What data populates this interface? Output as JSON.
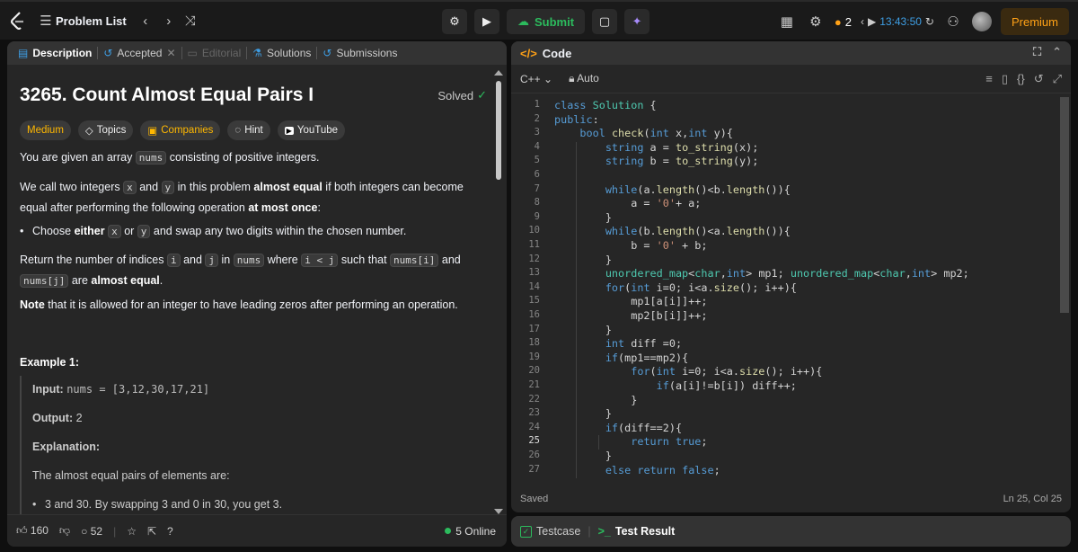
{
  "topbar": {
    "problem_list": "Problem List",
    "submit": "Submit",
    "streak": "2",
    "timer": "13:43:50",
    "premium": "Premium"
  },
  "left_tabs": [
    {
      "label": "Description",
      "active": true
    },
    {
      "label": "Accepted"
    },
    {
      "label": "Editorial"
    },
    {
      "label": "Solutions"
    },
    {
      "label": "Submissions"
    }
  ],
  "problem": {
    "title": "3265. Count Almost Equal Pairs I",
    "status": "Solved",
    "difficulty": "Medium",
    "chips": [
      "Topics",
      "Companies",
      "Hint",
      "YouTube"
    ],
    "p1_a": "You are given an array ",
    "p1_code": "nums",
    "p1_b": " consisting of positive integers.",
    "p2_a": "We call two integers ",
    "p2_x": "x",
    "p2_and": " and ",
    "p2_y": "y",
    "p2_b": " in this problem ",
    "p2_bold1": "almost equal",
    "p2_c": " if both integers can become equal after performing the following operation ",
    "p2_bold2": "at most once",
    "p2_d": ":",
    "bullet_a": "Choose ",
    "bullet_bold": "either",
    "bullet_x": "x",
    "bullet_or": " or ",
    "bullet_y": "y",
    "bullet_b": " and swap any two digits within the chosen number.",
    "p3_a": "Return the number of indices ",
    "p3_i": "i",
    "p3_and": " and ",
    "p3_j": "j",
    "p3_in": " in ",
    "p3_nums": "nums",
    "p3_where": " where ",
    "p3_cond": "i < j",
    "p3_such": " such that ",
    "p3_numsi": "nums[i]",
    "p3_and2": " and ",
    "p3_numsj": "nums[j]",
    "p3_are": " are ",
    "p3_bold": "almost equal",
    "p3_end": ".",
    "note_bold": "Note",
    "note_text": " that it is allowed for an integer to have leading zeros after performing an operation.",
    "example_title": "Example 1:",
    "input_label": "Input:",
    "input_value": "nums = [3,12,30,17,21]",
    "output_label": "Output:",
    "output_value": "2",
    "explanation_label": "Explanation:",
    "explanation_text": "The almost equal pairs of elements are:",
    "explanation_bullet": "3 and 30. By swapping 3 and 0 in 30, you get 3."
  },
  "footer": {
    "likes": "160",
    "comments": "52",
    "online": "5 Online"
  },
  "code": {
    "header": "Code",
    "language": "C++",
    "mode": "Auto",
    "saved": "Saved",
    "cursor": "Ln 25, Col 25",
    "lines": [
      "class Solution {",
      "public:",
      "    bool check(int x,int y){",
      "        string a = to_string(x);",
      "        string b = to_string(y);",
      "",
      "        while(a.length()<b.length()){",
      "            a = '0'+ a;",
      "        }",
      "        while(b.length()<a.length()){",
      "            b = '0' + b;",
      "        }",
      "        unordered_map<char,int> mp1; unordered_map<char,int> mp2;",
      "        for(int i=0; i<a.size(); i++){",
      "            mp1[a[i]]++;",
      "            mp2[b[i]]++;",
      "        }",
      "        int diff =0;",
      "        if(mp1==mp2){",
      "            for(int i=0; i<a.size(); i++){",
      "                if(a[i]!=b[i]) diff++;",
      "            }",
      "        }",
      "        if(diff==2){",
      "            return true;",
      "        }",
      "        else return false;"
    ]
  },
  "test_tabs": [
    "Testcase",
    "Test Result"
  ]
}
